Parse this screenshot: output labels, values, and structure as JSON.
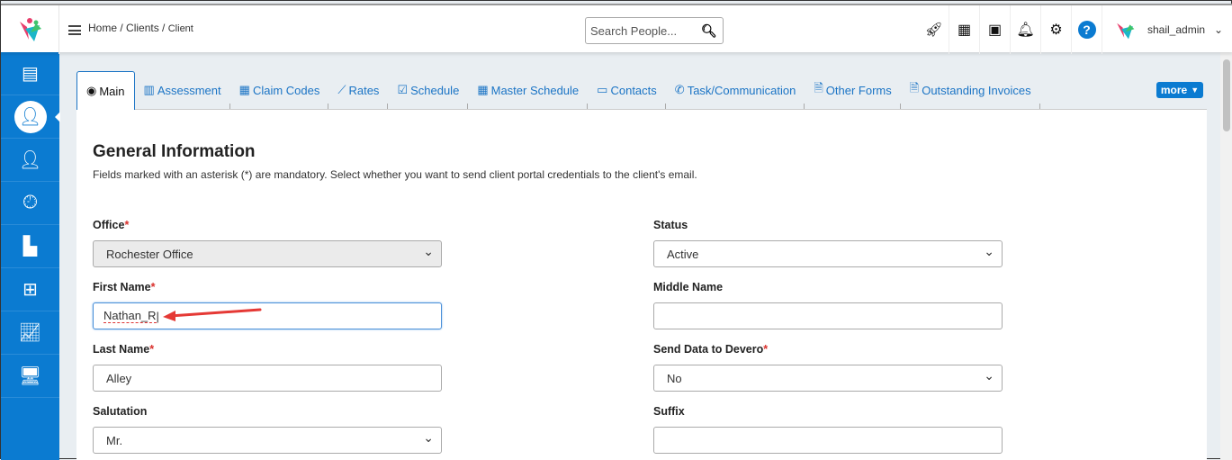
{
  "header": {
    "breadcrumb": [
      "Home",
      "Clients",
      "Client"
    ],
    "search_placeholder": "Search People...",
    "username": "shail_admin",
    "icons": [
      "rocket-icon",
      "calendar-icon",
      "address-book-icon",
      "bell-icon",
      "gear-icon",
      "help-icon"
    ]
  },
  "sidebar": {
    "items": [
      "dashboard-icon",
      "client-icon",
      "user-icon",
      "clock-icon",
      "cash-register-icon",
      "presentation-icon",
      "chart-line-icon",
      "monitor-icon"
    ]
  },
  "tabs": [
    {
      "label": "Main",
      "icon": "user-circle-icon"
    },
    {
      "label": "Assessment",
      "icon": "chart-bar-icon"
    },
    {
      "label": "Claim Codes",
      "icon": "building-icon"
    },
    {
      "label": "Rates",
      "icon": "chart-line-icon"
    },
    {
      "label": "Schedule",
      "icon": "calendar-check-icon"
    },
    {
      "label": "Master Schedule",
      "icon": "calendar-icon"
    },
    {
      "label": "Contacts",
      "icon": "id-card-icon"
    },
    {
      "label": "Task/Communication",
      "icon": "phone-icon"
    },
    {
      "label": "Other Forms",
      "icon": "file-icon"
    },
    {
      "label": "Outstanding Invoices",
      "icon": "file-icon"
    }
  ],
  "more_label": "more",
  "form": {
    "title": "General Information",
    "subtitle": "Fields marked with an asterisk (*) are mandatory. Select whether you want to send client portal credentials to the client's email.",
    "office": {
      "label": "Office",
      "value": "Rochester Office"
    },
    "status": {
      "label": "Status",
      "value": "Active"
    },
    "first_name": {
      "label": "First Name",
      "value": "Nathan_R"
    },
    "middle_name": {
      "label": "Middle Name",
      "value": ""
    },
    "last_name": {
      "label": "Last Name",
      "value": "Alley"
    },
    "send_data": {
      "label": "Send Data to Devero",
      "value": "No"
    },
    "salutation": {
      "label": "Salutation",
      "value": "Mr."
    },
    "suffix": {
      "label": "Suffix",
      "value": ""
    },
    "asterisk": "*"
  },
  "accent": "#0b7bd1"
}
